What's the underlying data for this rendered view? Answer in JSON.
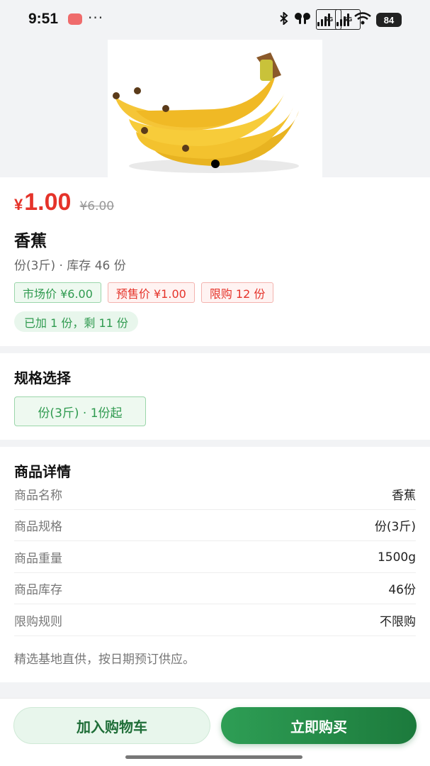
{
  "status_bar": {
    "time": "9:51",
    "dots": "···",
    "net1": "5G",
    "net2": "5G",
    "battery": "84"
  },
  "product": {
    "image_icon": "banana-image",
    "price_symbol": "¥",
    "price_now": "1.00",
    "price_old": "¥6.00",
    "name": "香蕉",
    "subtitle": "份(3斤) · 库存 46 份",
    "tags": [
      {
        "label": "市场价 ¥6.00",
        "color": "#2f9a4f"
      },
      {
        "label": "预售价 ¥1.00",
        "color": "#e5332a"
      },
      {
        "label": "限购 12 份",
        "color": "#e5332a"
      }
    ],
    "added_note": "已加 1 份，剩 11 份"
  },
  "spec": {
    "title": "规格选择",
    "option": "份(3斤) · 1份起"
  },
  "detail": {
    "title": "商品详情",
    "rows": [
      {
        "key": "商品名称",
        "value": "香蕉"
      },
      {
        "key": "商品规格",
        "value": "份(3斤)"
      },
      {
        "key": "商品重量",
        "value": "1500g"
      },
      {
        "key": "商品库存",
        "value": "46份"
      },
      {
        "key": "限购规则",
        "value": "不限购"
      }
    ],
    "note": "精选基地直供，按日期预订供应。"
  },
  "actions": {
    "add_to_cart": "加入购物车",
    "buy_now": "立即购买"
  },
  "colors": {
    "accent_green": "#2f9a4f",
    "price_red": "#e5332a"
  }
}
